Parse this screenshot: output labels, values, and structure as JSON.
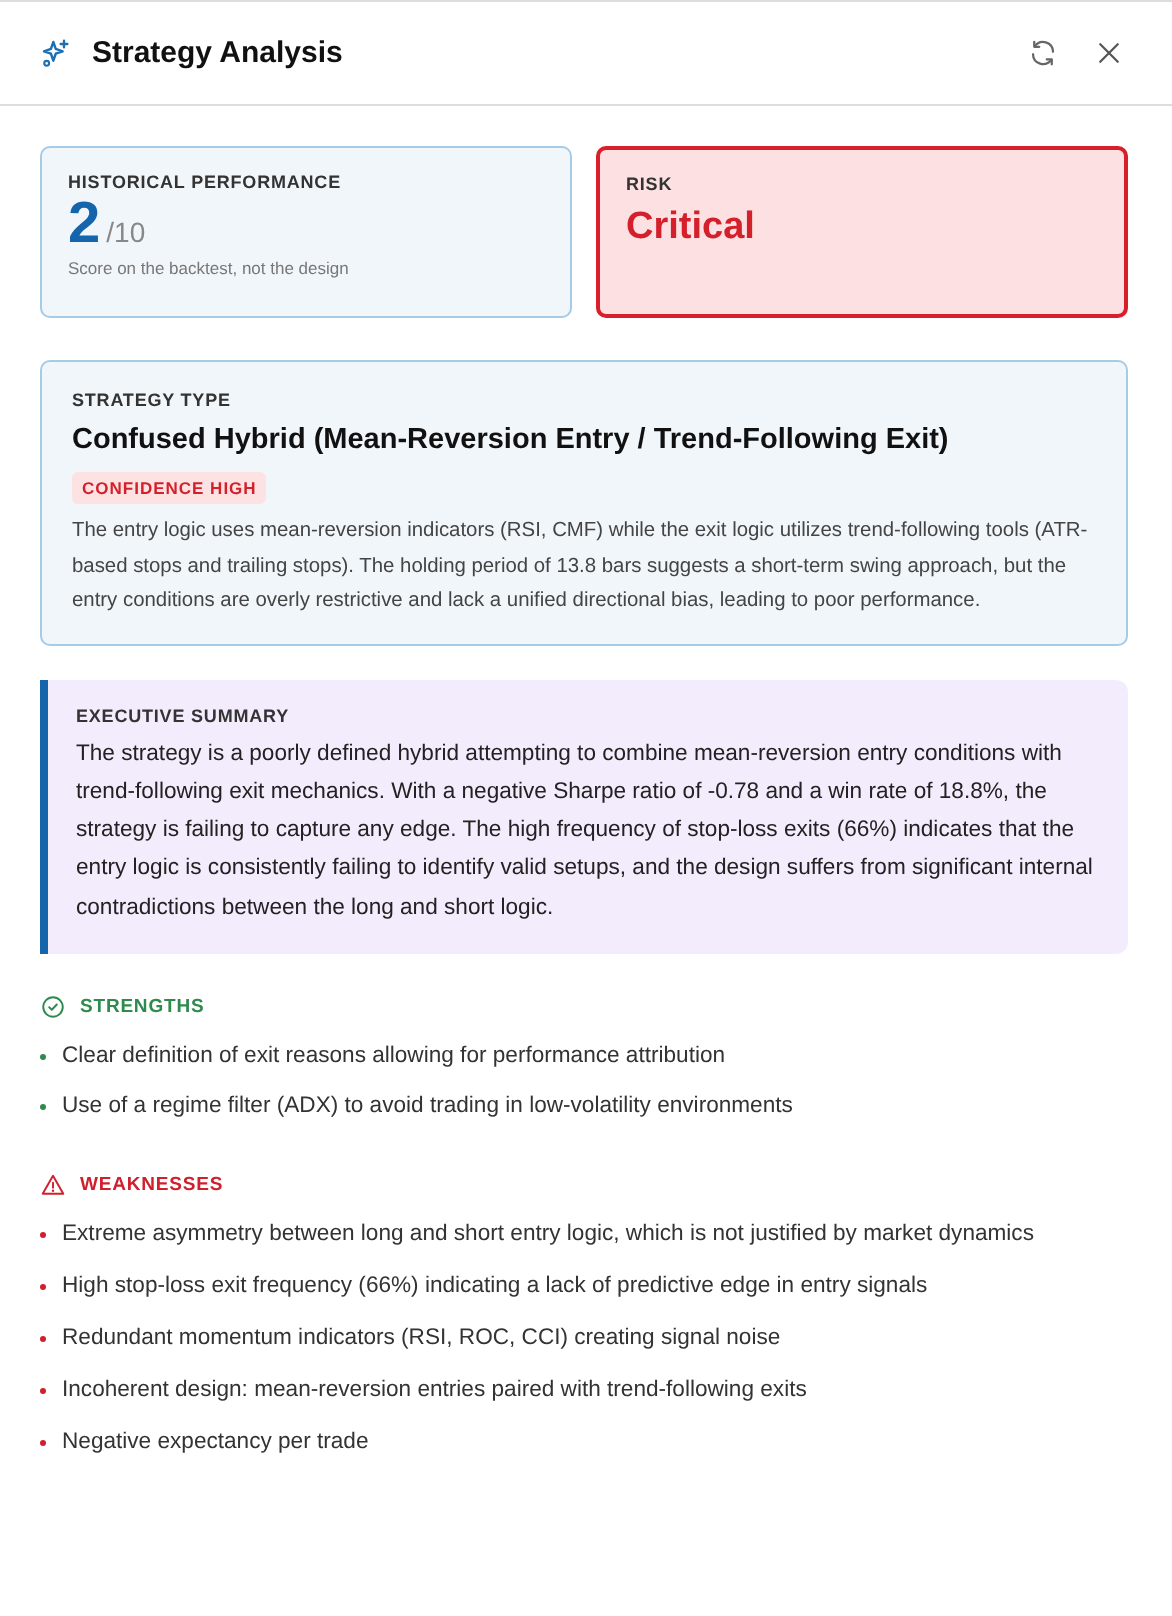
{
  "window": {
    "title": "Strategy Analysis"
  },
  "metrics": [
    {
      "kind": "score",
      "label": "HISTORICAL PERFORMANCE",
      "value": "2",
      "scale": "/10",
      "note": "Score on the backtest, not the design"
    },
    {
      "kind": "critical",
      "label": "RISK",
      "value": "Critical"
    }
  ],
  "strategy_type": {
    "label": "STRATEGY TYPE",
    "title": "Confused Hybrid (Mean-Reversion Entry / Trend-Following Exit)",
    "badge": "CONFIDENCE HIGH",
    "description": "The entry logic uses mean-reversion indicators (RSI, CMF) while the exit logic utilizes trend-following tools (ATR-based stops and trailing stops). The holding period of 13.8 bars suggests a short-term swing approach, but the entry conditions are overly restrictive and lack a unified directional bias, leading to poor performance."
  },
  "executive_summary": {
    "label": "EXECUTIVE SUMMARY",
    "text": "The strategy is a poorly defined hybrid attempting to combine mean-reversion entry conditions with trend-following exit mechanics. With a negative Sharpe ratio of -0.78 and a win rate of 18.8%, the strategy is failing to capture any edge. The high frequency of stop-loss exits (66%) indicates that the entry logic is consistently failing to identify valid setups, and the design suffers from significant internal contradictions between the long and short logic."
  },
  "sections": [
    {
      "kind": "strengths",
      "title": "STRENGTHS",
      "items": [
        "Clear definition of exit reasons allowing for performance attribution",
        "Use of a regime filter (ADX) to avoid trading in low-volatility environments"
      ]
    },
    {
      "kind": "weaknesses",
      "title": "WEAKNESSES",
      "items": [
        "Extreme asymmetry between long and short entry logic, which is not justified by market dynamics",
        "High stop-loss exit frequency (66%) indicating a lack of predictive edge in entry signals",
        "Redundant momentum indicators (RSI, ROC, CCI) creating signal noise",
        "Incoherent design: mean-reversion entries paired with trend-following exits",
        "Negative expectancy per trade"
      ]
    }
  ]
}
